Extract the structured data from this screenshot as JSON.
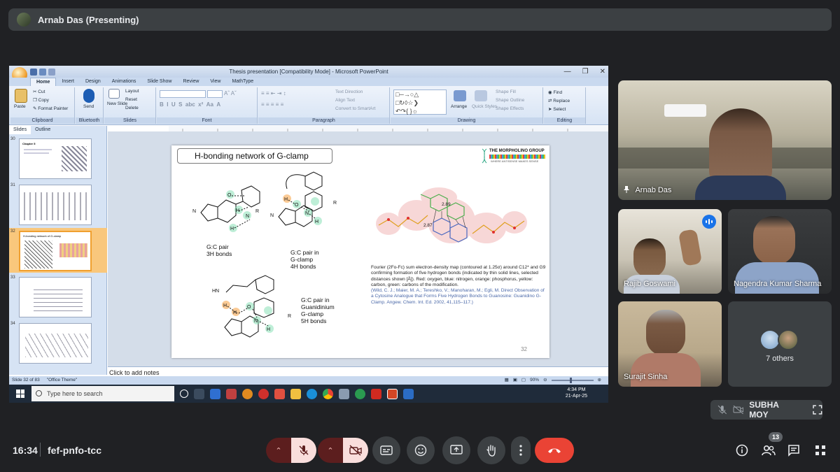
{
  "presenter": {
    "name": "Arnab Das (Presenting)"
  },
  "ppt": {
    "window_title": "Thesis presentation [Compatibility Mode] - Microsoft PowerPoint",
    "tabs": [
      "Home",
      "Insert",
      "Design",
      "Animations",
      "Slide Show",
      "Review",
      "View",
      "MathType"
    ],
    "ribbon": {
      "clipboard": {
        "label": "Clipboard",
        "paste": "Paste",
        "cut": "Cut",
        "copy": "Copy",
        "format_painter": "Format Painter"
      },
      "bluetooth": {
        "label": "Bluetooth",
        "send": "Send"
      },
      "slides": {
        "label": "Slides",
        "new_slide": "New Slide",
        "layout": "Layout",
        "reset": "Reset",
        "delete": "Delete"
      },
      "font": {
        "label": "Font"
      },
      "paragraph": {
        "label": "Paragraph",
        "text_direction": "Text Direction",
        "align_text": "Align Text",
        "convert_smartart": "Convert to SmartArt"
      },
      "drawing": {
        "label": "Drawing",
        "arrange": "Arrange",
        "quick_styles": "Quick Styles",
        "shape_fill": "Shape Fill",
        "shape_outline": "Shape Outline",
        "shape_effects": "Shape Effects"
      },
      "editing": {
        "label": "Editing",
        "find": "Find",
        "replace": "Replace",
        "select": "Select"
      }
    },
    "panel_tabs": [
      "Slides",
      "Outline"
    ],
    "thumbnails": [
      {
        "num": "30",
        "title": "Chapter 5"
      },
      {
        "num": "31",
        "title": ""
      },
      {
        "num": "32",
        "title": "H-bonding network of G-clamp"
      },
      {
        "num": "33",
        "title": ""
      },
      {
        "num": "34",
        "title": ""
      }
    ],
    "slide": {
      "title": "H-bonding network of G-clamp",
      "logo_text": "THE MORPHOLINO GROUP",
      "logo_sub": "WHERE ANTISENSE MAKES SENSE",
      "caption1": [
        "G:C pair",
        "3H bonds"
      ],
      "caption2": [
        "G:C pair in",
        "G-clamp",
        "4H bonds"
      ],
      "caption3": [
        "G:C pair in",
        "Guanidinium",
        "G-clamp",
        "5H bonds"
      ],
      "distance1": "2.87",
      "distance2": "2.89",
      "description": "Fourier (2Fo-Fc) sum electron-density map (contoured at 1.25σ) around C12* and G9 confirming formation of five hydrogen bonds (indicated by thin solid lines, selected distances shown [Å]). Red: oxygen, blue: nitrogen, orange: phosphorus, yellow: carbon, green: carbons of the modification.",
      "reference": "(Wild, C. J.; Maier, M. A.; Tereshko, V.; Manoharan, M.; Egli, M. Direct Observation of a Cytosine Analogue that Forms Five Hydrogen Bonds to Guanosine: Guanidino G-Clamp. Angew. Chem. Int. Ed. 2002, 41,115–117.)",
      "page_number": "32"
    },
    "notes_placeholder": "Click to add notes",
    "status": {
      "slide_info": "Slide 32 of 83",
      "theme": "\"Office Theme\"",
      "zoom": "90%"
    },
    "taskbar": {
      "search_placeholder": "Type here to search",
      "time": "4:34 PM",
      "date": "21-Apr-25"
    }
  },
  "participants": [
    {
      "name": "Arnab Das",
      "pinned": true
    },
    {
      "name": "Rajib Goswami",
      "speaking": true
    },
    {
      "name": "Nagendra Kumar Sharma"
    },
    {
      "name": "Surajit Sinha"
    }
  ],
  "others": {
    "label": "7 others"
  },
  "self": {
    "name": "SUBHA MOY"
  },
  "meeting": {
    "time": "16:34",
    "code": "fef-pnfo-tcc",
    "participant_count": "13"
  },
  "colors": {
    "background": "#202124",
    "tile": "#3c4043",
    "end_call": "#ea4335",
    "muted": "#f9dedc",
    "accent": "#1a73e8"
  },
  "icons": {
    "controls": [
      "mic-off-icon",
      "camera-off-icon",
      "captions-icon",
      "emoji-icon",
      "present-icon",
      "raise-hand-icon",
      "more-options-icon",
      "end-call-icon"
    ],
    "side": [
      "info-icon",
      "people-icon",
      "chat-icon",
      "activities-icon"
    ]
  }
}
